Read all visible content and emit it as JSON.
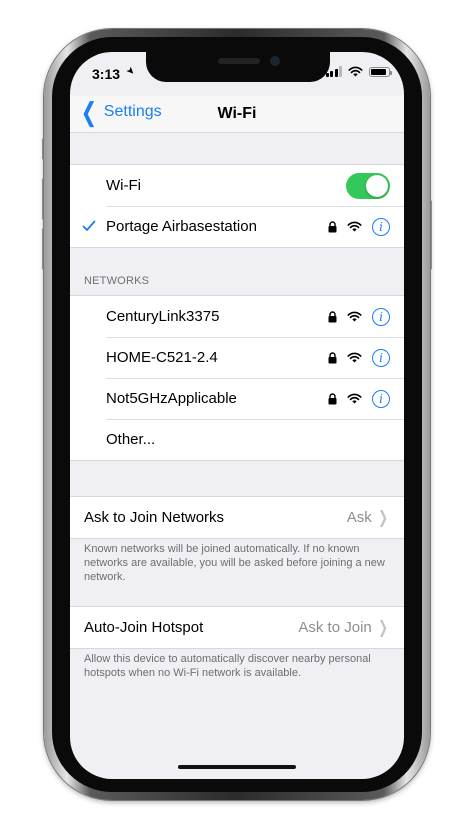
{
  "status_bar": {
    "time": "3:13",
    "signal_bars_active": 3,
    "battery_level": 0.9
  },
  "navbar": {
    "back_label": "Settings",
    "title": "Wi-Fi"
  },
  "wifi": {
    "label": "Wi-Fi",
    "enabled": true,
    "connected_network": "Portage Airbasestation"
  },
  "networks": {
    "header": "NETWORKS",
    "items": [
      {
        "name": "CenturyLink3375",
        "secured": true
      },
      {
        "name": "HOME-C521-2.4",
        "secured": true
      },
      {
        "name": "Not5GHzApplicable",
        "secured": true
      }
    ],
    "other_label": "Other..."
  },
  "ask_to_join": {
    "label": "Ask to Join Networks",
    "value": "Ask",
    "footer": "Known networks will be joined automatically. If no known networks are available, you will be asked before joining a new network."
  },
  "auto_join_hotspot": {
    "label": "Auto-Join Hotspot",
    "value": "Ask to Join",
    "footer": "Allow this device to automatically discover nearby personal hotspots when no Wi-Fi network is available."
  },
  "colors": {
    "accent": "#1a7ef7",
    "toggle_on": "#34c759",
    "background": "#efeff4"
  },
  "icons": [
    "location-icon",
    "signal-icon",
    "wifi-icon",
    "battery-icon",
    "chevron-left-icon",
    "checkmark-icon",
    "lock-icon",
    "info-icon",
    "chevron-right-icon"
  ]
}
